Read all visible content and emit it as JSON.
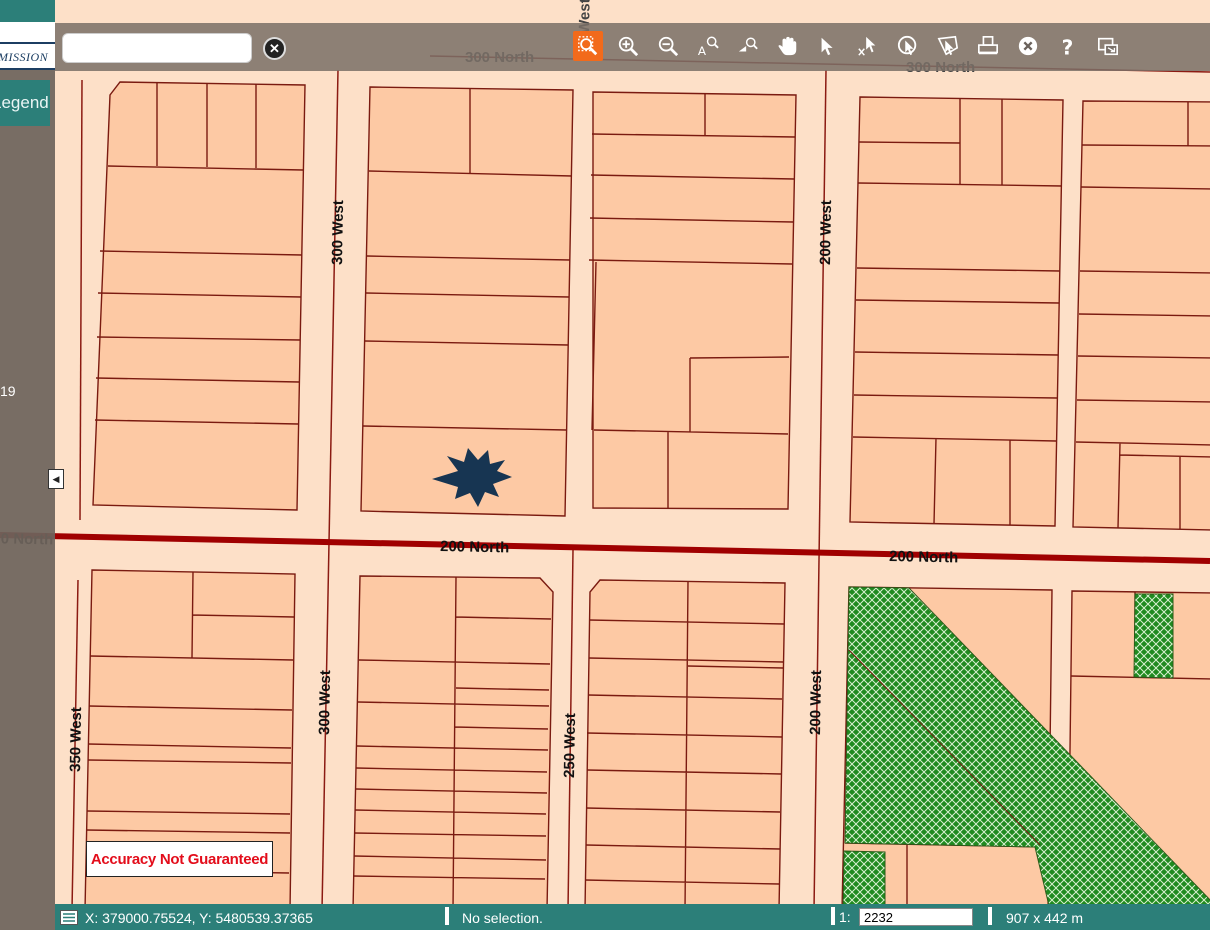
{
  "panel": {
    "logo_text": "MISSION",
    "legend_tab": "Legend",
    "panel_number": "19"
  },
  "search": {
    "value": "",
    "clear_icon": "close-circle-icon"
  },
  "toolbar": {
    "tools": [
      {
        "name": "zoom-box-icon",
        "active": true
      },
      {
        "name": "zoom-in-icon",
        "active": false
      },
      {
        "name": "zoom-out-icon",
        "active": false
      },
      {
        "name": "zoom-text-icon",
        "active": false
      },
      {
        "name": "zoom-previous-icon",
        "active": false
      },
      {
        "name": "pan-hand-icon",
        "active": false
      },
      {
        "name": "select-arrow-icon",
        "active": false
      },
      {
        "name": "select-clear-icon",
        "active": false
      },
      {
        "name": "select-circle-icon",
        "active": false
      },
      {
        "name": "select-polygon-icon",
        "active": false
      },
      {
        "name": "print-icon",
        "active": false
      },
      {
        "name": "clear-icon",
        "active": false
      },
      {
        "name": "help-icon",
        "active": false
      },
      {
        "name": "export-icon",
        "active": false
      }
    ],
    "accent_color": "#f26a1b"
  },
  "map": {
    "streets": {
      "n300": "300 North",
      "n200": "200 North",
      "w300": "300 West",
      "w200": "200 West",
      "w350": "350 West",
      "w250": "250 West",
      "west_top": "West"
    },
    "marker": "location-star-icon",
    "colors": {
      "parcel_fill": "#fdc9a4",
      "parcel_stroke": "#7a1a10",
      "background": "#fde0c8",
      "arterial": "#a00000",
      "park": "#1f8a1f"
    }
  },
  "disclaimer": "Accuracy Not Guaranteed",
  "status": {
    "coordinates": "X: 379000.75524, Y: 5480539.37365",
    "selection": "No selection.",
    "scale_prefix": "1:",
    "scale_value": "2232",
    "dimensions": "907 x 442 m"
  }
}
